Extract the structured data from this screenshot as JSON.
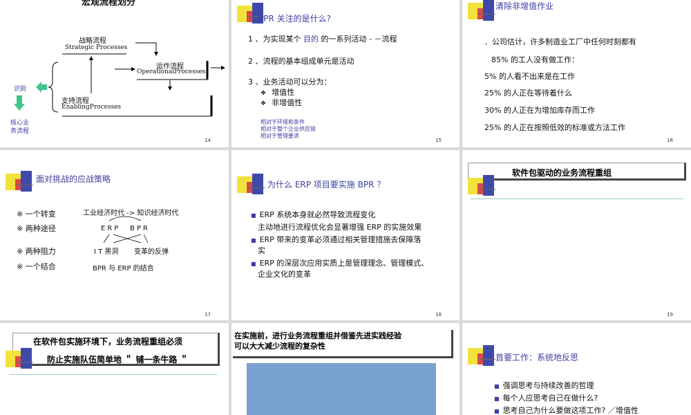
{
  "slides": [
    {
      "num": "14",
      "title": "宏观流程划分",
      "strategic_cn": "战略流程",
      "strategic_en": "Strategic Processes",
      "operational_cn": "运作流程",
      "operational_en": "OperationalProcesses",
      "enabling_cn": "支持流程",
      "enabling_en": "EnablingProcesses",
      "identify": "识别",
      "core_line1": "核心业",
      "core_line2": "务流程"
    },
    {
      "num": "15",
      "title": "BPR 关注的是什么?",
      "l1_pre": "1 、为实现某个 ",
      "l1_kw": "目的",
      "l1_post": " 的一系列活动 - －流程",
      "l2": "2 、流程的基本组成单元是活动",
      "l3": "3 、业务活动可以分为：",
      "sub1": "增值性",
      "sub2": "非增值性",
      "n1": "相对于环境和条件",
      "n2": "相对于整个企业供应链",
      "n3": "相对于管理要求"
    },
    {
      "num": "16",
      "title": "清除非增值作业",
      "l1": "．公司估计，许多制造业工厂中任何时刻都有",
      "l2": "85% 的工人没有做工作：",
      "l3": "5% 的人看不出来是在工作",
      "l4": "25% 的人正在等待着什么",
      "l5": "30% 的人正在为增加库存而工作",
      "l6": "25% 的人正在按照低效的标准或方法工作"
    },
    {
      "num": "17",
      "title": "面对挑战的应战策略",
      "r1_label": "※  一个转变",
      "r1_val": "工业经济时代 -> 知识经济时代",
      "r2_label": "※  两种途径",
      "r2_a": "ERP",
      "r2_b": "BPR",
      "r3_label": "※  两种阻力",
      "r3_a": "I T 黑洞",
      "r3_b": "变革的反弹",
      "r4_label": "※  一个结合",
      "r4_val": "BPR 与 ERP 的结合"
    },
    {
      "num": "18",
      "title": "为什么  ERP  项目要实施  BPR  ？",
      "b1a": "ERP 系统本身就必然导致流程变化",
      "b1b": "主动地进行流程优化会显著增强 ERP 的实施效果",
      "b2a": "ERP 带来的变革必须通过相关管理措施去保障落",
      "b2b": "实",
      "b3a": "ERP 的深层次应用实质上是管理理念、管理模式、",
      "b3b": "企业文化的变革"
    },
    {
      "num": "19",
      "title": "软件包驱动的业务流程重组"
    },
    {
      "line1": "在软件包实施环境下，业务流程重组必须",
      "line2": "防止实施队伍简单地 ＂ 铺一条牛路 ＂"
    },
    {
      "line1": "在实施前，进行业务流程重组并借鉴先进实践经验",
      "line2": "可以大大减少流程的复杂性",
      "box_color": "#7aa2d0"
    },
    {
      "title": "首要工作：系统地反思",
      "b1": "强调思考与持续改善的哲理",
      "b2": "每个人应思考自己在做什么?",
      "b3": "思考自己为什么要做这项工作? ／增值性"
    }
  ],
  "colors": {
    "accent": "#3b3fa0",
    "arrow_green": "#3fc48c",
    "deco_yellow": "#f3e23c",
    "deco_red": "#d83a4a",
    "deco_blue": "#3f4aa8"
  }
}
